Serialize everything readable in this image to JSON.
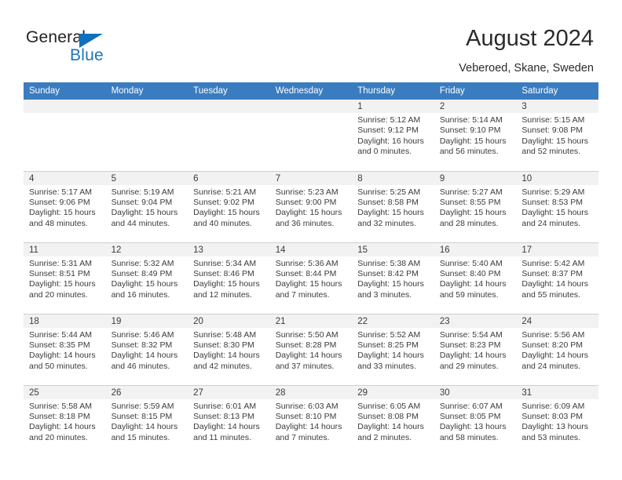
{
  "brand": {
    "name_part1": "General",
    "name_part2": "Blue",
    "triangle_color": "#1070bd",
    "blue_text_color": "#1b75bb"
  },
  "header": {
    "title": "August 2024",
    "subtitle": "Veberoed, Skane, Sweden",
    "header_bg_color": "#3a7cc0"
  },
  "weekdays": [
    "Sunday",
    "Monday",
    "Tuesday",
    "Wednesday",
    "Thursday",
    "Friday",
    "Saturday"
  ],
  "weeks": [
    [
      {
        "day": "",
        "empty": true
      },
      {
        "day": "",
        "empty": true
      },
      {
        "day": "",
        "empty": true
      },
      {
        "day": "",
        "empty": true
      },
      {
        "day": "1",
        "sunrise": "Sunrise: 5:12 AM",
        "sunset": "Sunset: 9:12 PM",
        "daylight1": "Daylight: 16 hours",
        "daylight2": "and 0 minutes."
      },
      {
        "day": "2",
        "sunrise": "Sunrise: 5:14 AM",
        "sunset": "Sunset: 9:10 PM",
        "daylight1": "Daylight: 15 hours",
        "daylight2": "and 56 minutes."
      },
      {
        "day": "3",
        "sunrise": "Sunrise: 5:15 AM",
        "sunset": "Sunset: 9:08 PM",
        "daylight1": "Daylight: 15 hours",
        "daylight2": "and 52 minutes."
      }
    ],
    [
      {
        "day": "4",
        "sunrise": "Sunrise: 5:17 AM",
        "sunset": "Sunset: 9:06 PM",
        "daylight1": "Daylight: 15 hours",
        "daylight2": "and 48 minutes."
      },
      {
        "day": "5",
        "sunrise": "Sunrise: 5:19 AM",
        "sunset": "Sunset: 9:04 PM",
        "daylight1": "Daylight: 15 hours",
        "daylight2": "and 44 minutes."
      },
      {
        "day": "6",
        "sunrise": "Sunrise: 5:21 AM",
        "sunset": "Sunset: 9:02 PM",
        "daylight1": "Daylight: 15 hours",
        "daylight2": "and 40 minutes."
      },
      {
        "day": "7",
        "sunrise": "Sunrise: 5:23 AM",
        "sunset": "Sunset: 9:00 PM",
        "daylight1": "Daylight: 15 hours",
        "daylight2": "and 36 minutes."
      },
      {
        "day": "8",
        "sunrise": "Sunrise: 5:25 AM",
        "sunset": "Sunset: 8:58 PM",
        "daylight1": "Daylight: 15 hours",
        "daylight2": "and 32 minutes."
      },
      {
        "day": "9",
        "sunrise": "Sunrise: 5:27 AM",
        "sunset": "Sunset: 8:55 PM",
        "daylight1": "Daylight: 15 hours",
        "daylight2": "and 28 minutes."
      },
      {
        "day": "10",
        "sunrise": "Sunrise: 5:29 AM",
        "sunset": "Sunset: 8:53 PM",
        "daylight1": "Daylight: 15 hours",
        "daylight2": "and 24 minutes."
      }
    ],
    [
      {
        "day": "11",
        "sunrise": "Sunrise: 5:31 AM",
        "sunset": "Sunset: 8:51 PM",
        "daylight1": "Daylight: 15 hours",
        "daylight2": "and 20 minutes."
      },
      {
        "day": "12",
        "sunrise": "Sunrise: 5:32 AM",
        "sunset": "Sunset: 8:49 PM",
        "daylight1": "Daylight: 15 hours",
        "daylight2": "and 16 minutes."
      },
      {
        "day": "13",
        "sunrise": "Sunrise: 5:34 AM",
        "sunset": "Sunset: 8:46 PM",
        "daylight1": "Daylight: 15 hours",
        "daylight2": "and 12 minutes."
      },
      {
        "day": "14",
        "sunrise": "Sunrise: 5:36 AM",
        "sunset": "Sunset: 8:44 PM",
        "daylight1": "Daylight: 15 hours",
        "daylight2": "and 7 minutes."
      },
      {
        "day": "15",
        "sunrise": "Sunrise: 5:38 AM",
        "sunset": "Sunset: 8:42 PM",
        "daylight1": "Daylight: 15 hours",
        "daylight2": "and 3 minutes."
      },
      {
        "day": "16",
        "sunrise": "Sunrise: 5:40 AM",
        "sunset": "Sunset: 8:40 PM",
        "daylight1": "Daylight: 14 hours",
        "daylight2": "and 59 minutes."
      },
      {
        "day": "17",
        "sunrise": "Sunrise: 5:42 AM",
        "sunset": "Sunset: 8:37 PM",
        "daylight1": "Daylight: 14 hours",
        "daylight2": "and 55 minutes."
      }
    ],
    [
      {
        "day": "18",
        "sunrise": "Sunrise: 5:44 AM",
        "sunset": "Sunset: 8:35 PM",
        "daylight1": "Daylight: 14 hours",
        "daylight2": "and 50 minutes."
      },
      {
        "day": "19",
        "sunrise": "Sunrise: 5:46 AM",
        "sunset": "Sunset: 8:32 PM",
        "daylight1": "Daylight: 14 hours",
        "daylight2": "and 46 minutes."
      },
      {
        "day": "20",
        "sunrise": "Sunrise: 5:48 AM",
        "sunset": "Sunset: 8:30 PM",
        "daylight1": "Daylight: 14 hours",
        "daylight2": "and 42 minutes."
      },
      {
        "day": "21",
        "sunrise": "Sunrise: 5:50 AM",
        "sunset": "Sunset: 8:28 PM",
        "daylight1": "Daylight: 14 hours",
        "daylight2": "and 37 minutes."
      },
      {
        "day": "22",
        "sunrise": "Sunrise: 5:52 AM",
        "sunset": "Sunset: 8:25 PM",
        "daylight1": "Daylight: 14 hours",
        "daylight2": "and 33 minutes."
      },
      {
        "day": "23",
        "sunrise": "Sunrise: 5:54 AM",
        "sunset": "Sunset: 8:23 PM",
        "daylight1": "Daylight: 14 hours",
        "daylight2": "and 29 minutes."
      },
      {
        "day": "24",
        "sunrise": "Sunrise: 5:56 AM",
        "sunset": "Sunset: 8:20 PM",
        "daylight1": "Daylight: 14 hours",
        "daylight2": "and 24 minutes."
      }
    ],
    [
      {
        "day": "25",
        "sunrise": "Sunrise: 5:58 AM",
        "sunset": "Sunset: 8:18 PM",
        "daylight1": "Daylight: 14 hours",
        "daylight2": "and 20 minutes."
      },
      {
        "day": "26",
        "sunrise": "Sunrise: 5:59 AM",
        "sunset": "Sunset: 8:15 PM",
        "daylight1": "Daylight: 14 hours",
        "daylight2": "and 15 minutes."
      },
      {
        "day": "27",
        "sunrise": "Sunrise: 6:01 AM",
        "sunset": "Sunset: 8:13 PM",
        "daylight1": "Daylight: 14 hours",
        "daylight2": "and 11 minutes."
      },
      {
        "day": "28",
        "sunrise": "Sunrise: 6:03 AM",
        "sunset": "Sunset: 8:10 PM",
        "daylight1": "Daylight: 14 hours",
        "daylight2": "and 7 minutes."
      },
      {
        "day": "29",
        "sunrise": "Sunrise: 6:05 AM",
        "sunset": "Sunset: 8:08 PM",
        "daylight1": "Daylight: 14 hours",
        "daylight2": "and 2 minutes."
      },
      {
        "day": "30",
        "sunrise": "Sunrise: 6:07 AM",
        "sunset": "Sunset: 8:05 PM",
        "daylight1": "Daylight: 13 hours",
        "daylight2": "and 58 minutes."
      },
      {
        "day": "31",
        "sunrise": "Sunrise: 6:09 AM",
        "sunset": "Sunset: 8:03 PM",
        "daylight1": "Daylight: 13 hours",
        "daylight2": "and 53 minutes."
      }
    ]
  ]
}
